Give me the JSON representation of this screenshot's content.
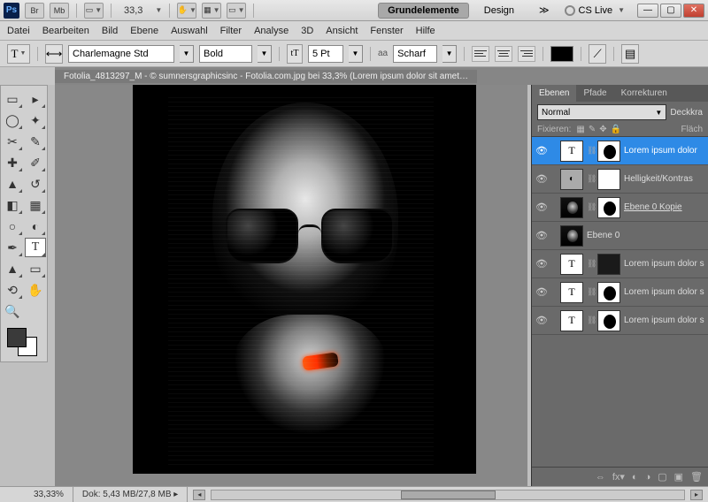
{
  "titlebar": {
    "zoom": "33,3",
    "workspace_active": "Grundelemente",
    "workspace_other": "Design",
    "cslive": "CS Live"
  },
  "menu": {
    "datei": "Datei",
    "bearbeiten": "Bearbeiten",
    "bild": "Bild",
    "ebene": "Ebene",
    "auswahl": "Auswahl",
    "filter": "Filter",
    "analyse": "Analyse",
    "dd": "3D",
    "ansicht": "Ansicht",
    "fenster": "Fenster",
    "hilfe": "Hilfe"
  },
  "options": {
    "font": "Charlemagne Std",
    "weight": "Bold",
    "size": "5 Pt",
    "aa_label": "aa",
    "aa_value": "Scharf"
  },
  "document": {
    "title": "Fotolia_4813297_M - © sumnersgraphicsinc - Fotolia.com.jpg bei 33,3% (Lorem ipsum dolor sit amet…"
  },
  "panels": {
    "tabs": {
      "ebenen": "Ebenen",
      "pfade": "Pfade",
      "korrekturen": "Korrekturen"
    },
    "blend": "Normal",
    "opacity_label": "Deckkra",
    "fixieren": "Fixieren:",
    "fill_label": "Fläch"
  },
  "layers": [
    {
      "name": "Lorem ipsum dolor",
      "type": "T",
      "mask": true,
      "sel": true
    },
    {
      "name": "Helligkeit/Kontras",
      "type": "adj",
      "mask": "white"
    },
    {
      "name": "Ebene 0 Kopie",
      "type": "img",
      "mask": true,
      "underline": true
    },
    {
      "name": "Ebene 0",
      "type": "img"
    },
    {
      "name": "Lorem ipsum dolor s",
      "type": "T",
      "mask": "dark"
    },
    {
      "name": "Lorem ipsum dolor s",
      "type": "T",
      "mask": true
    },
    {
      "name": "Lorem ipsum dolor s",
      "type": "T",
      "mask": true
    }
  ],
  "status": {
    "zoom": "33,33%",
    "doc": "Dok: 5,43 MB/27,8 MB"
  }
}
